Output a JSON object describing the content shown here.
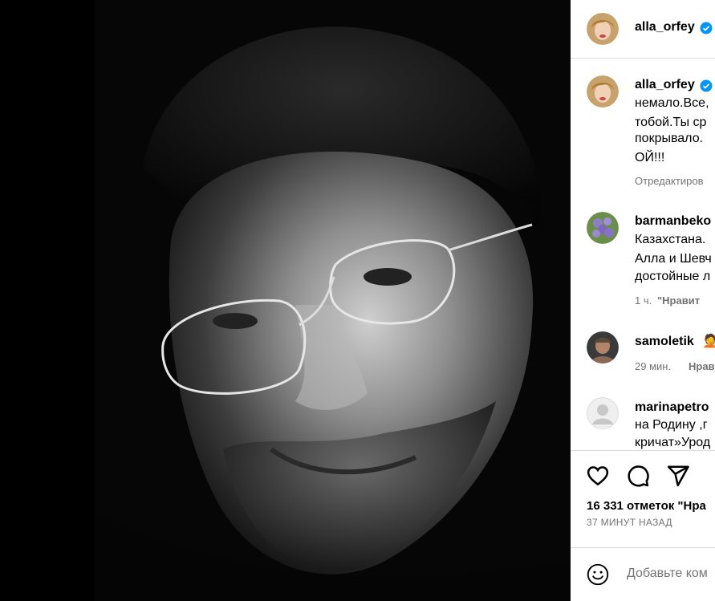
{
  "post": {
    "author": "alla_orfey",
    "caption_lines": [
      "немало.Все,",
      "тобой.Ты ср",
      "покрывало.",
      "ОЙ!!!"
    ],
    "edited_label": "Отредактиров"
  },
  "comments": [
    {
      "username": "barmanbeko",
      "lines": [
        "Казахстана.",
        "Алла и Шевч",
        "достойные л"
      ],
      "time": "1 ч.",
      "action": "\"Нравит"
    },
    {
      "username": "samoletik",
      "emoji": "🤦",
      "lines": [],
      "time": "29 мин.",
      "action": "Нрав"
    },
    {
      "username": "marinapetro",
      "lines": [
        "на Родину ,г",
        "кричат»Урод"
      ]
    }
  ],
  "actions": {
    "like_icon": "heart-icon",
    "comment_icon": "comment-icon",
    "share_icon": "share-icon"
  },
  "likes_text": "16 331 отметок \"Нра",
  "time_ago": "37 МИНУТ НАЗАД",
  "add_comment": {
    "emoji_icon": "smiley-icon",
    "placeholder": "Добавьте ком"
  },
  "colors": {
    "verified": "#0095f6",
    "muted": "#737373",
    "divider": "#dbdbdb"
  }
}
